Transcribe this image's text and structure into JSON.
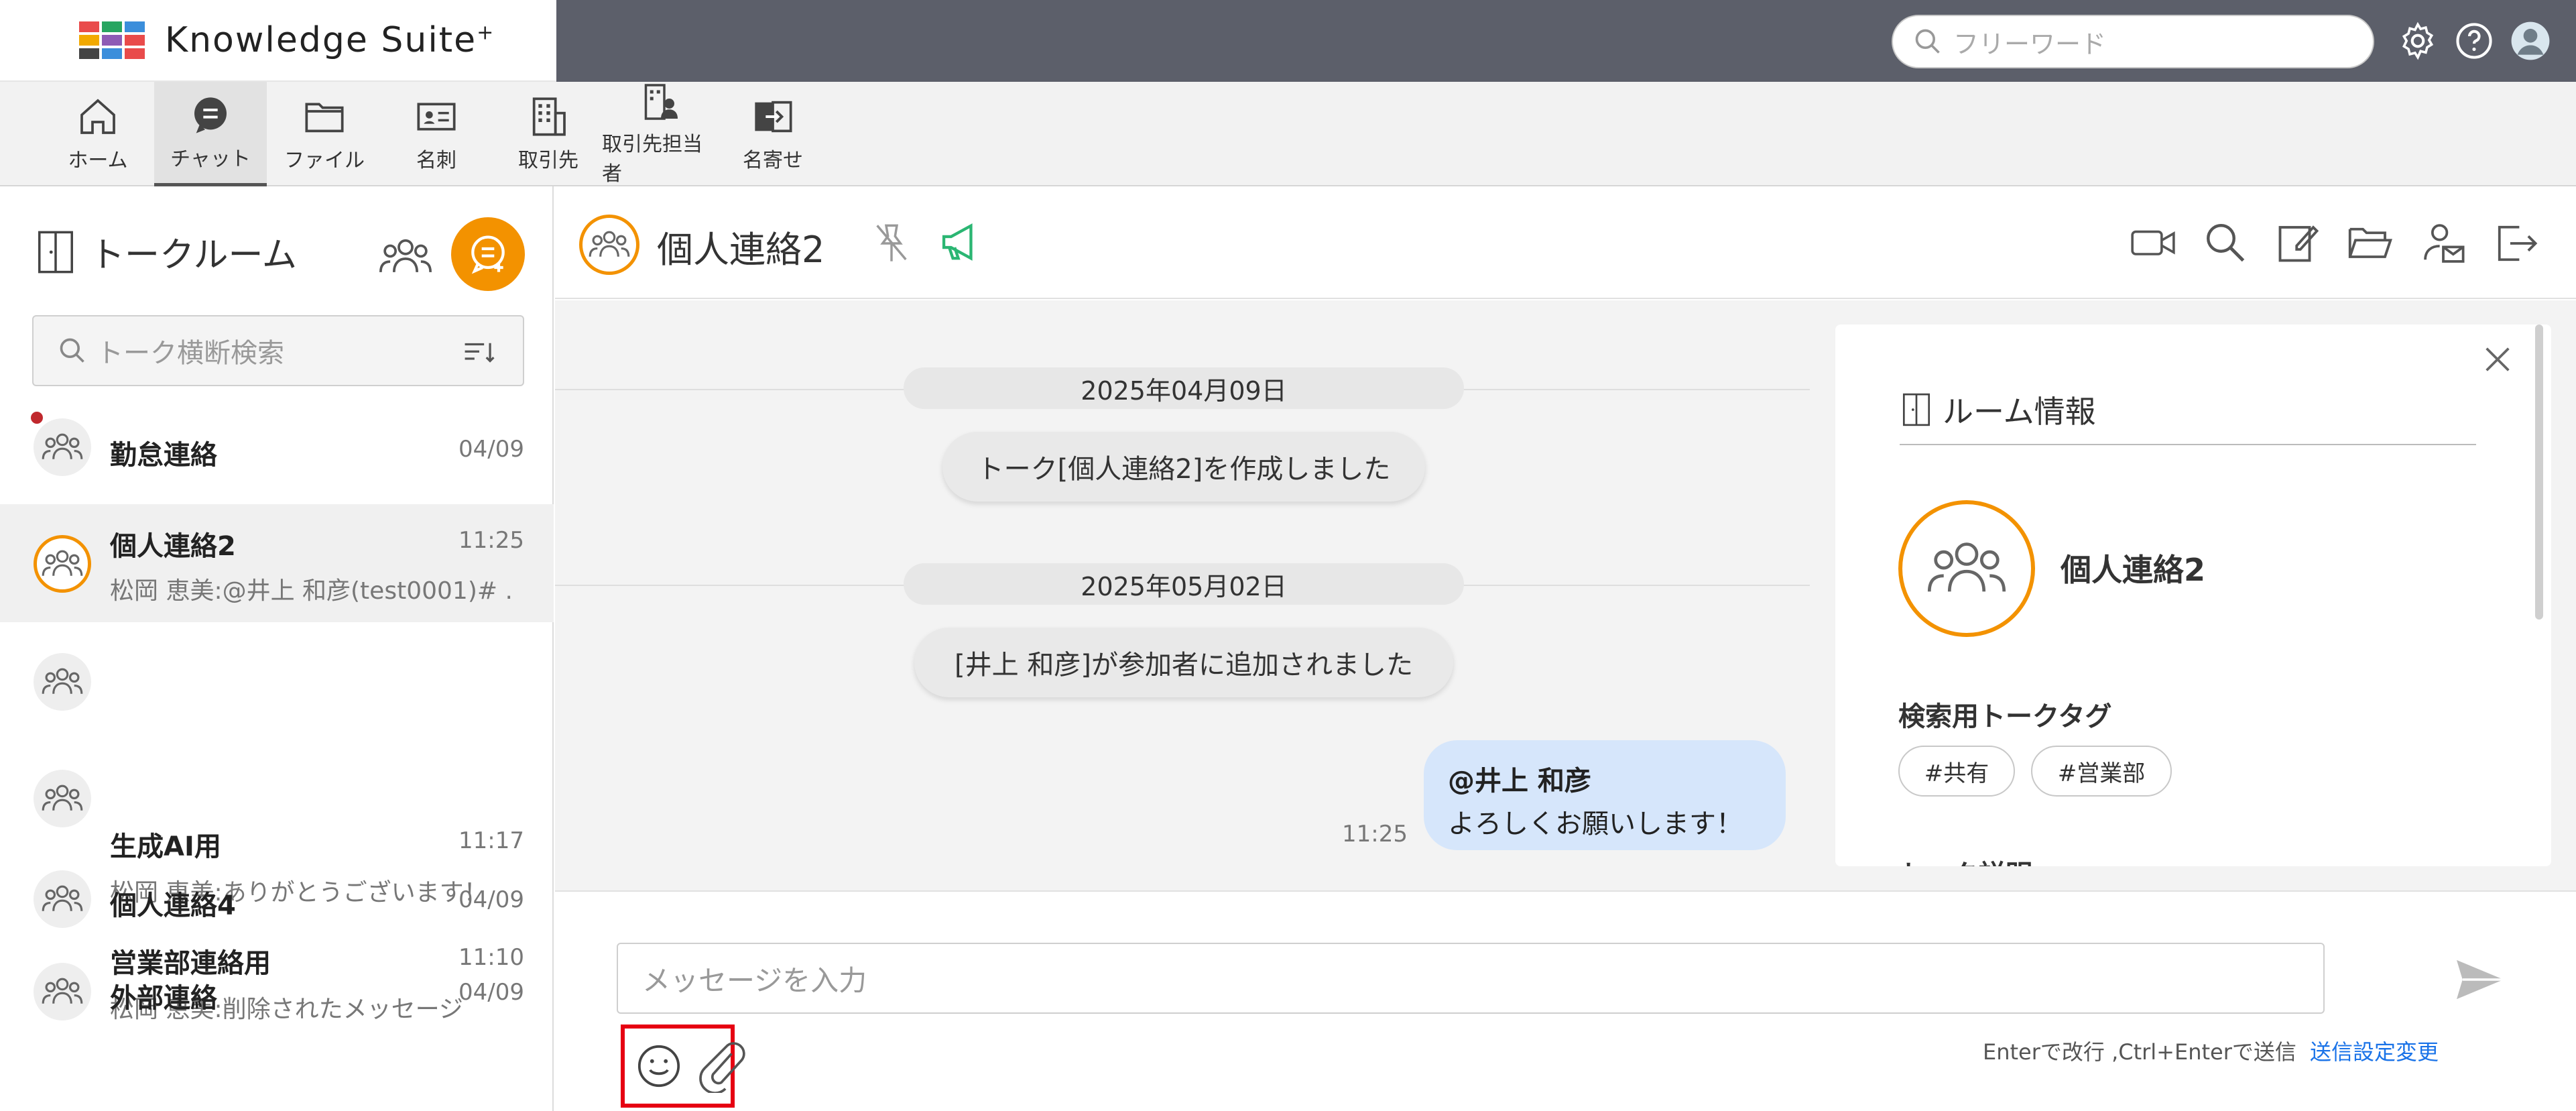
{
  "app": {
    "title": "Knowledge Suite",
    "title_suffix": "+",
    "search_placeholder": "フリーワード"
  },
  "nav": {
    "items": [
      {
        "label": "ホーム",
        "icon": "home-icon"
      },
      {
        "label": "チャット",
        "icon": "chat-icon",
        "active": true
      },
      {
        "label": "ファイル",
        "icon": "folder-icon"
      },
      {
        "label": "名刺",
        "icon": "business-card-icon"
      },
      {
        "label": "取引先",
        "icon": "building-icon"
      },
      {
        "label": "取引先担当者",
        "icon": "building-person-icon"
      },
      {
        "label": "名寄せ",
        "icon": "merge-icon"
      }
    ]
  },
  "sidebar": {
    "title": "トークルーム",
    "search_placeholder": "トーク横断検索",
    "rooms": [
      {
        "name": "勤怠連絡",
        "time": "04/09",
        "preview": "",
        "unread": true
      },
      {
        "name": "個人連絡2",
        "time": "11:25",
        "preview": "松岡 恵美:@井上 和彦(test0001)# ...",
        "active": true
      },
      {
        "name": "生成AI用",
        "time": "11:17",
        "preview": "松岡 恵美:ありがとうございます！"
      },
      {
        "name": "営業部連絡用",
        "time": "11:10",
        "preview": "松岡 恵美:削除されたメッセージ"
      },
      {
        "name": "個人連絡4",
        "time": "04/09",
        "preview": ""
      },
      {
        "name": "外部連絡",
        "time": "04/09",
        "preview": ""
      }
    ]
  },
  "chat": {
    "room_name": "個人連絡2",
    "messages": {
      "date1": "2025年04月09日",
      "sys1": "トーク[個人連絡2]を作成しました",
      "date2": "2025年05月02日",
      "sys2": "[井上  和彦]が参加者に追加されました",
      "mention": "@井上  和彦",
      "text": "よろしくお願いします！",
      "time": "11:25"
    }
  },
  "info_panel": {
    "title": "ルーム情報",
    "room_name": "個人連絡2",
    "tag_label": "検索用トークタグ",
    "tags": [
      "#共有",
      "#営業部"
    ],
    "more_label": "トーク説明"
  },
  "composer": {
    "placeholder": "メッセージを入力",
    "hint": "Enterで改行 ,Ctrl+Enterで送信",
    "settings_link": "送信設定変更"
  },
  "colors": {
    "accent": "#f39200",
    "topbar": "#5c5f6a",
    "highlight": "#e60012",
    "link": "#1a73e8"
  }
}
